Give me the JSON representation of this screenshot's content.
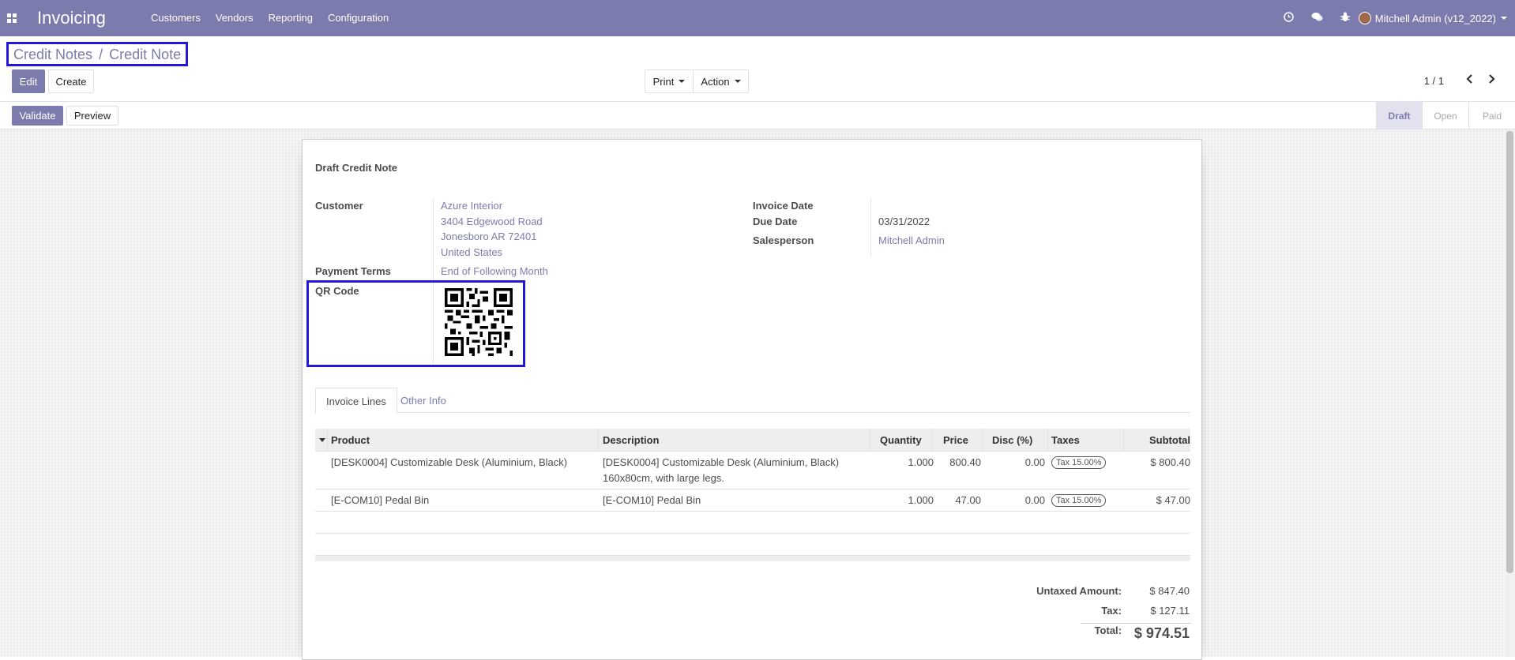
{
  "navbar": {
    "app_name": "Invoicing",
    "menu": [
      "Customers",
      "Vendors",
      "Reporting",
      "Configuration"
    ],
    "user": "Mitchell Admin (v12_2022)",
    "icons": [
      "clock-icon",
      "chat-icon",
      "bug-icon"
    ]
  },
  "breadcrumb": {
    "parent": "Credit Notes",
    "separator": "/",
    "current": "Credit Note"
  },
  "buttons": {
    "edit": "Edit",
    "create": "Create",
    "print": "Print",
    "action": "Action",
    "validate": "Validate",
    "preview": "Preview"
  },
  "pager": {
    "value": "1 / 1"
  },
  "status_steps": [
    "Draft",
    "Open",
    "Paid"
  ],
  "status_active": "Draft",
  "form": {
    "title": "Draft Credit Note",
    "customer_label": "Customer",
    "customer_name": "Azure Interior",
    "customer_address": [
      "3404 Edgewood Road",
      "Jonesboro AR 72401",
      "United States"
    ],
    "payment_terms_label": "Payment Terms",
    "payment_terms": "End of Following Month",
    "qr_label": "QR Code",
    "invoice_date_label": "Invoice Date",
    "invoice_date": "",
    "due_date_label": "Due Date",
    "due_date": "03/31/2022",
    "salesperson_label": "Salesperson",
    "salesperson": "Mitchell Admin"
  },
  "tabs": [
    "Invoice Lines",
    "Other Info"
  ],
  "table": {
    "headers": [
      "Product",
      "Description",
      "Quantity",
      "Price",
      "Disc (%)",
      "Taxes",
      "Subtotal"
    ],
    "rows": [
      {
        "product": "[DESK0004] Customizable Desk (Aluminium, Black)",
        "description": [
          "[DESK0004] Customizable Desk (Aluminium, Black)",
          "160x80cm, with large legs."
        ],
        "quantity": "1.000",
        "price": "800.40",
        "discount": "0.00",
        "tax": "Tax 15.00%",
        "subtotal": "$ 800.40"
      },
      {
        "product": "[E-COM10] Pedal Bin",
        "description": [
          "[E-COM10] Pedal Bin"
        ],
        "quantity": "1.000",
        "price": "47.00",
        "discount": "0.00",
        "tax": "Tax 15.00%",
        "subtotal": "$ 47.00"
      }
    ]
  },
  "totals": {
    "untaxed_label": "Untaxed Amount:",
    "untaxed": "$ 847.40",
    "tax_label": "Tax:",
    "tax": "$ 127.11",
    "total_label": "Total:",
    "total": "$ 974.51"
  },
  "colors": {
    "brand": "#7c7bad",
    "highlight_box": "#2318d9"
  }
}
